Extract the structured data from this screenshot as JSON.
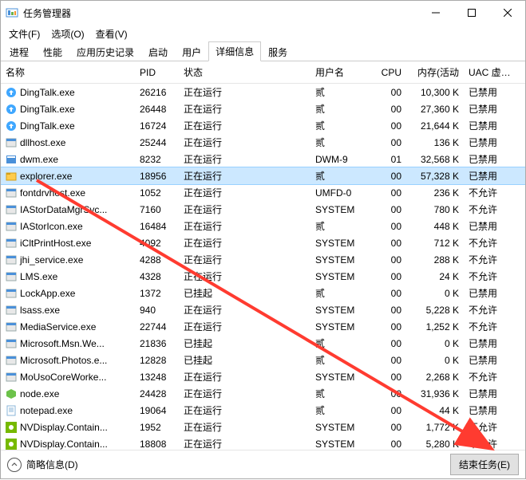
{
  "window": {
    "title": "任务管理器",
    "minimize": "−",
    "maximize": "□",
    "close": "✕"
  },
  "menu": {
    "file": "文件(F)",
    "options": "选项(O)",
    "view": "查看(V)"
  },
  "tabs": {
    "processes": "进程",
    "performance": "性能",
    "history": "应用历史记录",
    "startup": "启动",
    "users": "用户",
    "details": "详细信息",
    "services": "服务"
  },
  "headers": {
    "name": "名称",
    "pid": "PID",
    "status": "状态",
    "user": "用户名",
    "cpu": "CPU",
    "memory": "内存(活动",
    "uac": "UAC 虚拟化"
  },
  "processes": [
    {
      "name": "DingTalk.exe",
      "pid": "26216",
      "status": "正在运行",
      "user": "贰",
      "cpu": "00",
      "mem": "10,300 K",
      "uac": "已禁用",
      "icon": "ding"
    },
    {
      "name": "DingTalk.exe",
      "pid": "26448",
      "status": "正在运行",
      "user": "贰",
      "cpu": "00",
      "mem": "27,360 K",
      "uac": "已禁用",
      "icon": "ding"
    },
    {
      "name": "DingTalk.exe",
      "pid": "16724",
      "status": "正在运行",
      "user": "贰",
      "cpu": "00",
      "mem": "21,644 K",
      "uac": "已禁用",
      "icon": "ding"
    },
    {
      "name": "dllhost.exe",
      "pid": "25244",
      "status": "正在运行",
      "user": "贰",
      "cpu": "00",
      "mem": "136 K",
      "uac": "已禁用",
      "icon": "generic"
    },
    {
      "name": "dwm.exe",
      "pid": "8232",
      "status": "正在运行",
      "user": "DWM-9",
      "cpu": "01",
      "mem": "32,568 K",
      "uac": "已禁用",
      "icon": "dwm"
    },
    {
      "name": "explorer.exe",
      "pid": "18956",
      "status": "正在运行",
      "user": "贰",
      "cpu": "00",
      "mem": "57,328 K",
      "uac": "已禁用",
      "icon": "explorer",
      "selected": true
    },
    {
      "name": "fontdrvhost.exe",
      "pid": "1052",
      "status": "正在运行",
      "user": "UMFD-0",
      "cpu": "00",
      "mem": "236 K",
      "uac": "不允许",
      "icon": "generic"
    },
    {
      "name": "IAStorDataMgrSvc...",
      "pid": "7160",
      "status": "正在运行",
      "user": "SYSTEM",
      "cpu": "00",
      "mem": "780 K",
      "uac": "不允许",
      "icon": "generic"
    },
    {
      "name": "IAStorIcon.exe",
      "pid": "16484",
      "status": "正在运行",
      "user": "贰",
      "cpu": "00",
      "mem": "448 K",
      "uac": "已禁用",
      "icon": "generic"
    },
    {
      "name": "iCltPrintHost.exe",
      "pid": "4092",
      "status": "正在运行",
      "user": "SYSTEM",
      "cpu": "00",
      "mem": "712 K",
      "uac": "不允许",
      "icon": "generic"
    },
    {
      "name": "jhi_service.exe",
      "pid": "4288",
      "status": "正在运行",
      "user": "SYSTEM",
      "cpu": "00",
      "mem": "288 K",
      "uac": "不允许",
      "icon": "generic"
    },
    {
      "name": "LMS.exe",
      "pid": "4328",
      "status": "正在运行",
      "user": "SYSTEM",
      "cpu": "00",
      "mem": "24 K",
      "uac": "不允许",
      "icon": "generic"
    },
    {
      "name": "LockApp.exe",
      "pid": "1372",
      "status": "已挂起",
      "user": "贰",
      "cpu": "00",
      "mem": "0 K",
      "uac": "已禁用",
      "icon": "generic"
    },
    {
      "name": "lsass.exe",
      "pid": "940",
      "status": "正在运行",
      "user": "SYSTEM",
      "cpu": "00",
      "mem": "5,228 K",
      "uac": "不允许",
      "icon": "generic"
    },
    {
      "name": "MediaService.exe",
      "pid": "22744",
      "status": "正在运行",
      "user": "SYSTEM",
      "cpu": "00",
      "mem": "1,252 K",
      "uac": "不允许",
      "icon": "generic"
    },
    {
      "name": "Microsoft.Msn.We...",
      "pid": "21836",
      "status": "已挂起",
      "user": "贰",
      "cpu": "00",
      "mem": "0 K",
      "uac": "已禁用",
      "icon": "generic"
    },
    {
      "name": "Microsoft.Photos.e...",
      "pid": "12828",
      "status": "已挂起",
      "user": "贰",
      "cpu": "00",
      "mem": "0 K",
      "uac": "已禁用",
      "icon": "generic"
    },
    {
      "name": "MoUsoCoreWorke...",
      "pid": "13248",
      "status": "正在运行",
      "user": "SYSTEM",
      "cpu": "00",
      "mem": "2,268 K",
      "uac": "不允许",
      "icon": "generic"
    },
    {
      "name": "node.exe",
      "pid": "24428",
      "status": "正在运行",
      "user": "贰",
      "cpu": "00",
      "mem": "31,936 K",
      "uac": "已禁用",
      "icon": "node"
    },
    {
      "name": "notepad.exe",
      "pid": "19064",
      "status": "正在运行",
      "user": "贰",
      "cpu": "00",
      "mem": "44 K",
      "uac": "已禁用",
      "icon": "notepad"
    },
    {
      "name": "NVDisplay.Contain...",
      "pid": "1952",
      "status": "正在运行",
      "user": "SYSTEM",
      "cpu": "00",
      "mem": "1,772 K",
      "uac": "不允许",
      "icon": "nvidia"
    },
    {
      "name": "NVDisplay.Contain...",
      "pid": "18808",
      "status": "正在运行",
      "user": "SYSTEM",
      "cpu": "00",
      "mem": "5,280 K",
      "uac": "不允许",
      "icon": "nvidia"
    }
  ],
  "footer": {
    "brief": "简略信息(D)",
    "end": "结束任务(E)"
  }
}
